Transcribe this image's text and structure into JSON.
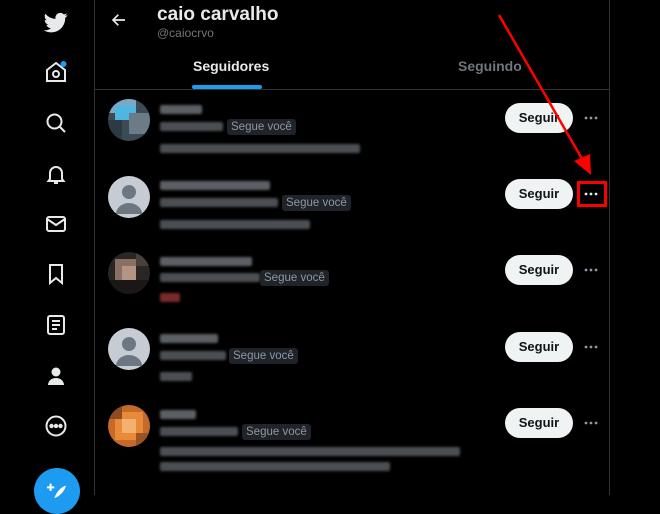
{
  "profile": {
    "name": "caio carvalho",
    "handle": "@caiocrvo"
  },
  "tabs": [
    {
      "label": "Seguidores",
      "active": true
    },
    {
      "label": "Seguindo",
      "active": false
    }
  ],
  "nav": {
    "items": [
      "twitter-logo",
      "home-icon",
      "explore-icon",
      "notifications-icon",
      "messages-icon",
      "bookmarks-icon",
      "lists-icon",
      "profile-icon",
      "more-icon"
    ],
    "compose": "compose-tweet"
  },
  "rows": [
    {
      "badge": "Segue você",
      "follow_label": "Seguir"
    },
    {
      "badge": "Segue você",
      "follow_label": "Seguir"
    },
    {
      "badge": "Segue você",
      "follow_label": "Seguir"
    },
    {
      "badge": "Segue você",
      "follow_label": "Seguir"
    },
    {
      "badge": "Segue você",
      "follow_label": "Seguir"
    }
  ],
  "colors": {
    "accent": "#1d9bf0",
    "highlight": "#ff0000",
    "background": "#000000"
  }
}
